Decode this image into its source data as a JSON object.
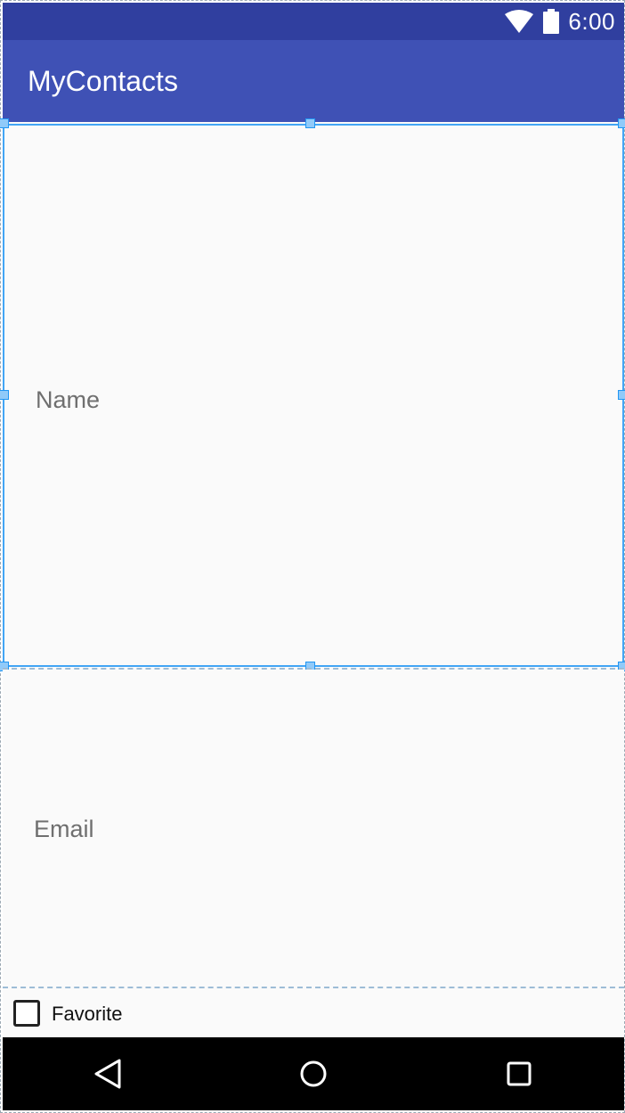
{
  "status_bar": {
    "time": "6:00",
    "icons": [
      "wifi-icon",
      "battery-icon"
    ]
  },
  "app_bar": {
    "title": "MyContacts",
    "color": "#3f51b5",
    "status_color": "#303f9f"
  },
  "form": {
    "name_placeholder": "Name",
    "email_placeholder": "Email",
    "favorite_label": "Favorite",
    "favorite_checked": false
  },
  "selection": {
    "color": "#42a5f5"
  },
  "nav_bar": {
    "buttons": [
      "back-icon",
      "home-icon",
      "recents-icon"
    ]
  }
}
